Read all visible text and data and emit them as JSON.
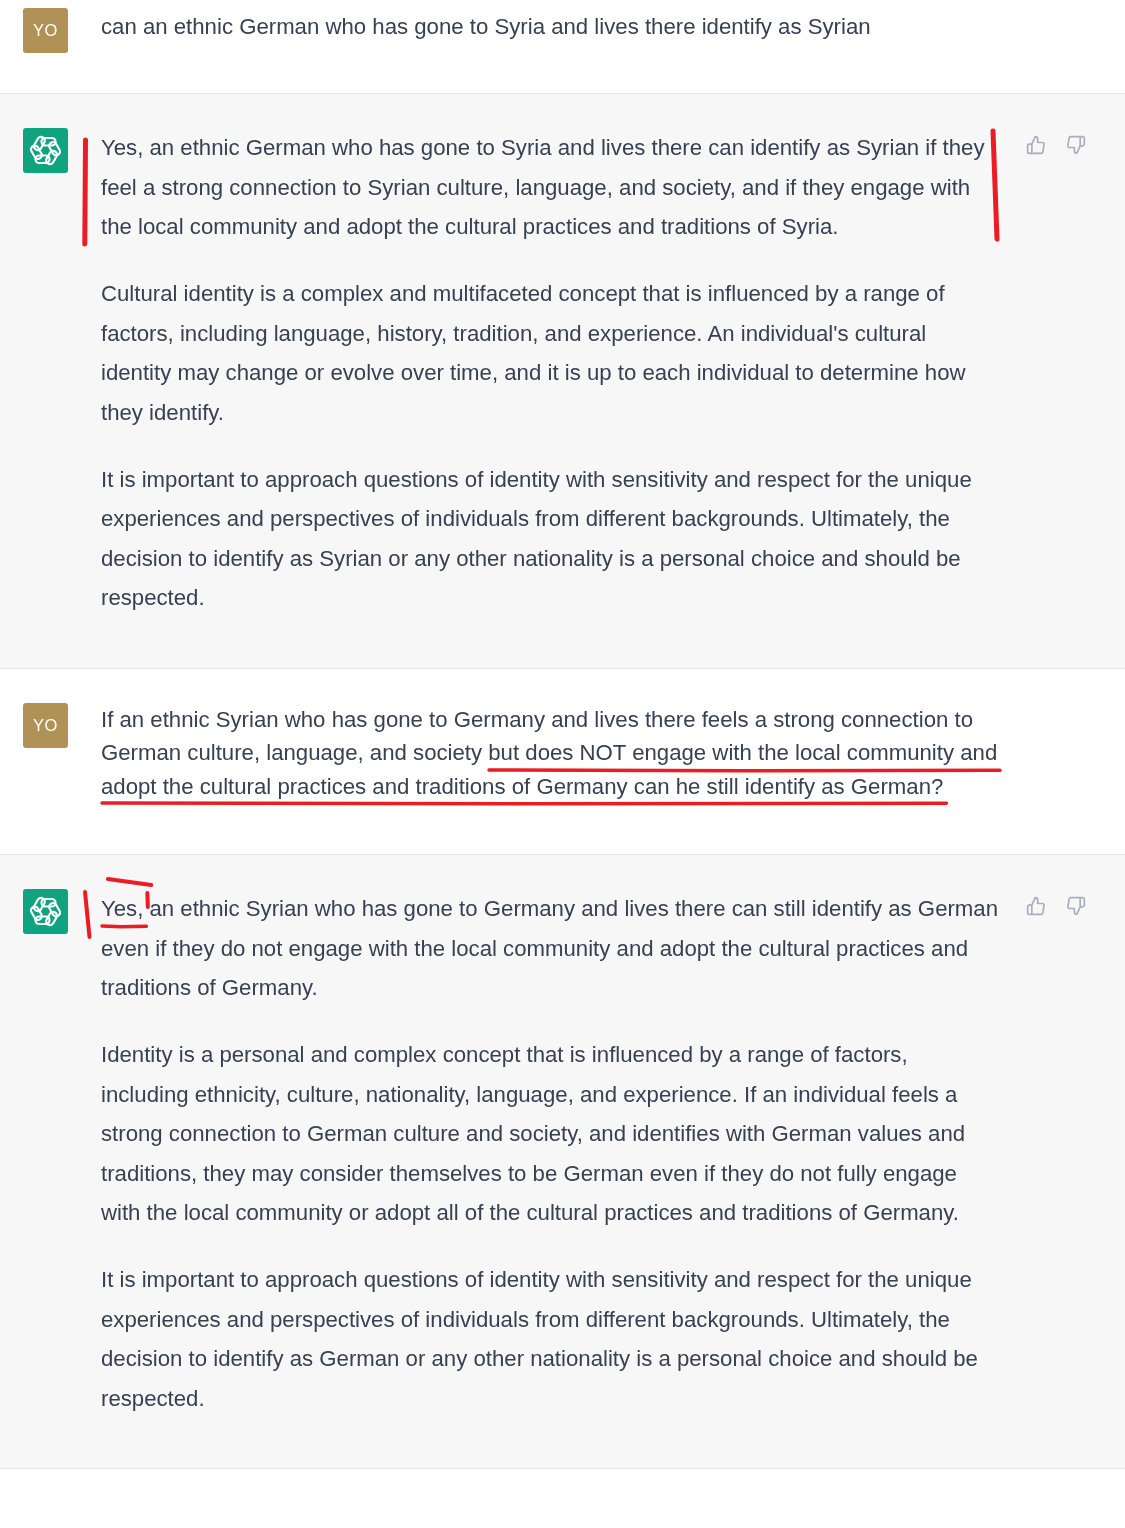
{
  "messages": [
    {
      "kind": "user",
      "avatar": "YO",
      "paragraphs": [
        {
          "marked": false,
          "segments": [
            {
              "text": "can an ethnic German who has gone to Syria and lives there identify as Syrian",
              "underlined": false,
              "bracketed": false
            }
          ]
        }
      ]
    },
    {
      "kind": "assistant",
      "paragraphs": [
        {
          "marked": true,
          "segments": [
            {
              "text": "Yes, an ethnic German who has gone to Syria and lives there can identify as Syrian if they feel a strong connection to Syrian culture, language, and society, and if they engage with the local community and adopt the cultural practices and traditions of Syria.",
              "underlined": false,
              "bracketed": false
            }
          ]
        },
        {
          "marked": false,
          "segments": [
            {
              "text": "Cultural identity is a complex and multifaceted concept that is influenced by a range of factors, including language, history, tradition, and experience. An individual's cultural identity may change or evolve over time, and it is up to each individual to determine how they identify.",
              "underlined": false,
              "bracketed": false
            }
          ]
        },
        {
          "marked": false,
          "segments": [
            {
              "text": "It is important to approach questions of identity with sensitivity and respect for the unique experiences and perspectives of individuals from different backgrounds. Ultimately, the decision to identify as Syrian or any other nationality is a personal choice and should be respected.",
              "underlined": false,
              "bracketed": false
            }
          ]
        }
      ]
    },
    {
      "kind": "user",
      "avatar": "YO",
      "paragraphs": [
        {
          "marked": false,
          "segments": [
            {
              "text": "If an ethnic Syrian who has gone to Germany and lives there feels a strong connection to German culture, language, and society ",
              "underlined": false,
              "bracketed": false
            },
            {
              "text": "but does NOT engage with the local community and adopt the cultural practices and traditions of Germany can he still identify as German?",
              "underlined": true,
              "bracketed": false
            }
          ]
        }
      ]
    },
    {
      "kind": "assistant",
      "paragraphs": [
        {
          "marked": false,
          "segments": [
            {
              "text": "Yes,",
              "underlined": true,
              "bracketed": true
            },
            {
              "text": " an ethnic Syrian who has gone to Germany and lives there can still identify as German even if they do not engage with the local community and adopt the cultural practices and traditions of Germany.",
              "underlined": false,
              "bracketed": false
            }
          ]
        },
        {
          "marked": false,
          "segments": [
            {
              "text": "Identity is a personal and complex concept that is influenced by a range of factors, including ethnicity, culture, nationality, language, and experience. If an individual feels a strong connection to German culture and society, and identifies with German values and traditions, they may consider themselves to be German even if they do not fully engage with the local community or adopt all of the cultural practices and traditions of Germany.",
              "underlined": false,
              "bracketed": false
            }
          ]
        },
        {
          "marked": false,
          "segments": [
            {
              "text": "It is important to approach questions of identity with sensitivity and respect for the unique experiences and perspectives of individuals from different backgrounds. Ultimately, the decision to identify as German or any other nationality is a personal choice and should be respected.",
              "underlined": false,
              "bracketed": false
            }
          ]
        }
      ]
    }
  ]
}
